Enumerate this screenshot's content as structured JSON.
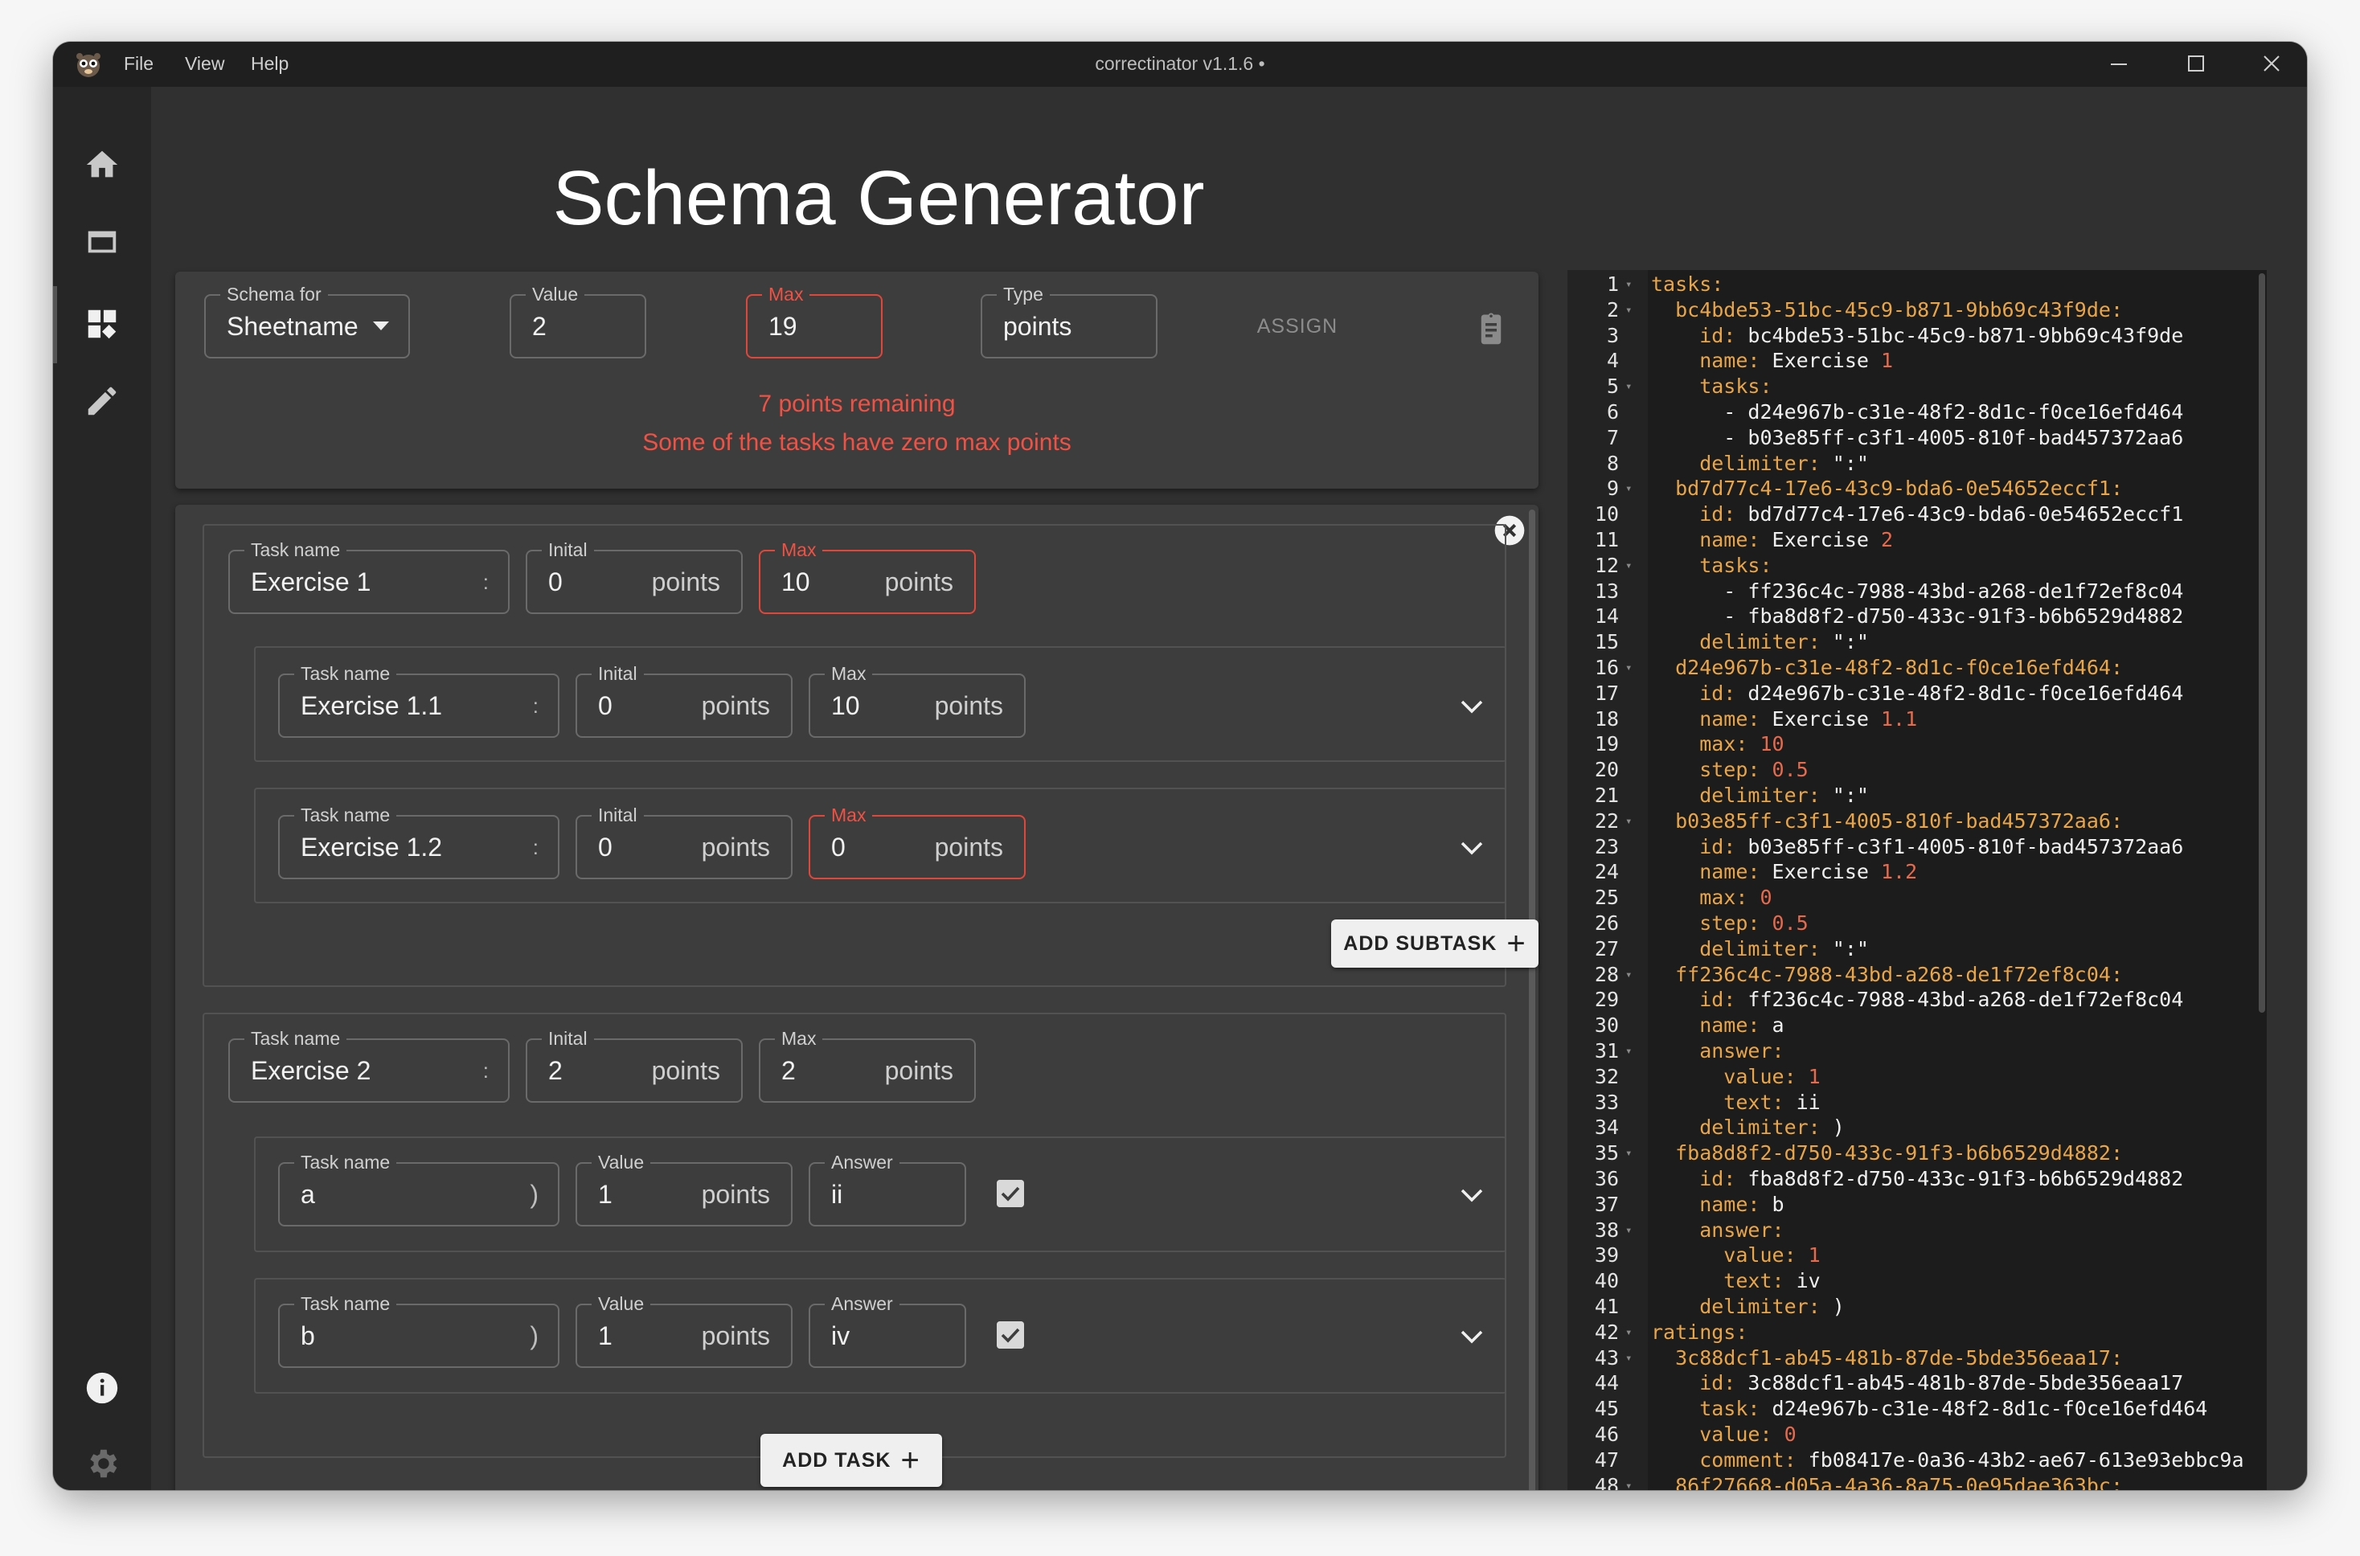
{
  "window": {
    "title": "correctinator v1.1.6 •",
    "menu": [
      "File",
      "View",
      "Help"
    ]
  },
  "page": {
    "title": "Schema Generator"
  },
  "top_panel": {
    "schema_for": {
      "label": "Schema for",
      "value": "Sheetname"
    },
    "value": {
      "label": "Value",
      "value": "2"
    },
    "max": {
      "label": "Max",
      "value": "19"
    },
    "type": {
      "label": "Type",
      "value": "points"
    },
    "assign_label": "ASSIGN",
    "messages": [
      "7 points remaining",
      "Some of the tasks have zero max points"
    ]
  },
  "task1": {
    "name": {
      "label": "Task name",
      "value": "Exercise 1",
      "delimiter": ":"
    },
    "initial": {
      "label": "Inital",
      "value": "0",
      "unit": "points"
    },
    "max": {
      "label": "Max",
      "value": "10",
      "unit": "points"
    },
    "subtasks": [
      {
        "name": {
          "label": "Task name",
          "value": "Exercise 1.1",
          "delimiter": ":"
        },
        "initial": {
          "label": "Inital",
          "value": "0",
          "unit": "points"
        },
        "max": {
          "label": "Max",
          "value": "10",
          "unit": "points"
        }
      },
      {
        "name": {
          "label": "Task name",
          "value": "Exercise 1.2",
          "delimiter": ":"
        },
        "initial": {
          "label": "Inital",
          "value": "0",
          "unit": "points"
        },
        "max": {
          "label": "Max",
          "value": "0",
          "unit": "points"
        }
      }
    ],
    "add_subtask_label": "ADD SUBTASK"
  },
  "task2": {
    "name": {
      "label": "Task name",
      "value": "Exercise 2",
      "delimiter": ":"
    },
    "initial": {
      "label": "Inital",
      "value": "2",
      "unit": "points"
    },
    "max": {
      "label": "Max",
      "value": "2",
      "unit": "points"
    },
    "subtasks": [
      {
        "name": {
          "label": "Task name",
          "value": "a",
          "delimiter": ")"
        },
        "value": {
          "label": "Value",
          "value": "1",
          "unit": "points"
        },
        "answer": {
          "label": "Answer",
          "value": "ii"
        },
        "checked": true
      },
      {
        "name": {
          "label": "Task name",
          "value": "b",
          "delimiter": ")"
        },
        "value": {
          "label": "Value",
          "value": "1",
          "unit": "points"
        },
        "answer": {
          "label": "Answer",
          "value": "iv"
        },
        "checked": true
      }
    ]
  },
  "add_task_label": "ADD TASK",
  "colors": {
    "error": "#ef5244",
    "yaml_key": "#e8a54a",
    "yaml_number": "#e76a4d"
  },
  "yaml": {
    "lines": [
      {
        "n": "1",
        "fold": true,
        "parts": [
          {
            "t": "tasks:",
            "c": "k"
          }
        ]
      },
      {
        "n": "2",
        "fold": true,
        "parts": [
          {
            "t": "  bc4bde53-51bc-45c9-b871-9bb69c43f9de:",
            "c": "k"
          }
        ]
      },
      {
        "n": "3",
        "fold": false,
        "parts": [
          {
            "t": "    id: ",
            "c": "k"
          },
          {
            "t": "bc4bde53-51bc-45c9-b871-9bb69c43f9de",
            "c": "v"
          }
        ]
      },
      {
        "n": "4",
        "fold": false,
        "parts": [
          {
            "t": "    name: ",
            "c": "k"
          },
          {
            "t": "Exercise ",
            "c": "v"
          },
          {
            "t": "1",
            "c": "n"
          }
        ]
      },
      {
        "n": "5",
        "fold": true,
        "parts": [
          {
            "t": "    tasks:",
            "c": "k"
          }
        ]
      },
      {
        "n": "6",
        "fold": false,
        "parts": [
          {
            "t": "      - d24e967b-c31e-48f2-8d1c-f0ce16efd464",
            "c": "v"
          }
        ]
      },
      {
        "n": "7",
        "fold": false,
        "parts": [
          {
            "t": "      - b03e85ff-c3f1-4005-810f-bad457372aa6",
            "c": "v"
          }
        ]
      },
      {
        "n": "8",
        "fold": false,
        "parts": [
          {
            "t": "    delimiter: ",
            "c": "k"
          },
          {
            "t": "\":\"",
            "c": "s"
          }
        ]
      },
      {
        "n": "9",
        "fold": true,
        "parts": [
          {
            "t": "  bd7d77c4-17e6-43c9-bda6-0e54652eccf1:",
            "c": "k"
          }
        ]
      },
      {
        "n": "10",
        "fold": false,
        "parts": [
          {
            "t": "    id: ",
            "c": "k"
          },
          {
            "t": "bd7d77c4-17e6-43c9-bda6-0e54652eccf1",
            "c": "v"
          }
        ]
      },
      {
        "n": "11",
        "fold": false,
        "parts": [
          {
            "t": "    name: ",
            "c": "k"
          },
          {
            "t": "Exercise ",
            "c": "v"
          },
          {
            "t": "2",
            "c": "n"
          }
        ]
      },
      {
        "n": "12",
        "fold": true,
        "parts": [
          {
            "t": "    tasks:",
            "c": "k"
          }
        ]
      },
      {
        "n": "13",
        "fold": false,
        "parts": [
          {
            "t": "      - ff236c4c-7988-43bd-a268-de1f72ef8c04",
            "c": "v"
          }
        ]
      },
      {
        "n": "14",
        "fold": false,
        "parts": [
          {
            "t": "      - fba8d8f2-d750-433c-91f3-b6b6529d4882",
            "c": "v"
          }
        ]
      },
      {
        "n": "15",
        "fold": false,
        "parts": [
          {
            "t": "    delimiter: ",
            "c": "k"
          },
          {
            "t": "\":\"",
            "c": "s"
          }
        ]
      },
      {
        "n": "16",
        "fold": true,
        "parts": [
          {
            "t": "  d24e967b-c31e-48f2-8d1c-f0ce16efd464:",
            "c": "k"
          }
        ]
      },
      {
        "n": "17",
        "fold": false,
        "parts": [
          {
            "t": "    id: ",
            "c": "k"
          },
          {
            "t": "d24e967b-c31e-48f2-8d1c-f0ce16efd464",
            "c": "v"
          }
        ]
      },
      {
        "n": "18",
        "fold": false,
        "parts": [
          {
            "t": "    name: ",
            "c": "k"
          },
          {
            "t": "Exercise ",
            "c": "v"
          },
          {
            "t": "1.1",
            "c": "n"
          }
        ]
      },
      {
        "n": "19",
        "fold": false,
        "parts": [
          {
            "t": "    max: ",
            "c": "k"
          },
          {
            "t": "10",
            "c": "n"
          }
        ]
      },
      {
        "n": "20",
        "fold": false,
        "parts": [
          {
            "t": "    step: ",
            "c": "k"
          },
          {
            "t": "0.5",
            "c": "n"
          }
        ]
      },
      {
        "n": "21",
        "fold": false,
        "parts": [
          {
            "t": "    delimiter: ",
            "c": "k"
          },
          {
            "t": "\":\"",
            "c": "s"
          }
        ]
      },
      {
        "n": "22",
        "fold": true,
        "parts": [
          {
            "t": "  b03e85ff-c3f1-4005-810f-bad457372aa6:",
            "c": "k"
          }
        ]
      },
      {
        "n": "23",
        "fold": false,
        "parts": [
          {
            "t": "    id: ",
            "c": "k"
          },
          {
            "t": "b03e85ff-c3f1-4005-810f-bad457372aa6",
            "c": "v"
          }
        ]
      },
      {
        "n": "24",
        "fold": false,
        "parts": [
          {
            "t": "    name: ",
            "c": "k"
          },
          {
            "t": "Exercise ",
            "c": "v"
          },
          {
            "t": "1.2",
            "c": "n"
          }
        ]
      },
      {
        "n": "25",
        "fold": false,
        "parts": [
          {
            "t": "    max: ",
            "c": "k"
          },
          {
            "t": "0",
            "c": "n"
          }
        ]
      },
      {
        "n": "26",
        "fold": false,
        "parts": [
          {
            "t": "    step: ",
            "c": "k"
          },
          {
            "t": "0.5",
            "c": "n"
          }
        ]
      },
      {
        "n": "27",
        "fold": false,
        "parts": [
          {
            "t": "    delimiter: ",
            "c": "k"
          },
          {
            "t": "\":\"",
            "c": "s"
          }
        ]
      },
      {
        "n": "28",
        "fold": true,
        "parts": [
          {
            "t": "  ff236c4c-7988-43bd-a268-de1f72ef8c04:",
            "c": "k"
          }
        ]
      },
      {
        "n": "29",
        "fold": false,
        "parts": [
          {
            "t": "    id: ",
            "c": "k"
          },
          {
            "t": "ff236c4c-7988-43bd-a268-de1f72ef8c04",
            "c": "v"
          }
        ]
      },
      {
        "n": "30",
        "fold": false,
        "parts": [
          {
            "t": "    name: ",
            "c": "k"
          },
          {
            "t": "a",
            "c": "v"
          }
        ]
      },
      {
        "n": "31",
        "fold": true,
        "parts": [
          {
            "t": "    answer:",
            "c": "k"
          }
        ]
      },
      {
        "n": "32",
        "fold": false,
        "parts": [
          {
            "t": "      value: ",
            "c": "k"
          },
          {
            "t": "1",
            "c": "n"
          }
        ]
      },
      {
        "n": "33",
        "fold": false,
        "parts": [
          {
            "t": "      text: ",
            "c": "k"
          },
          {
            "t": "ii",
            "c": "v"
          }
        ]
      },
      {
        "n": "34",
        "fold": false,
        "parts": [
          {
            "t": "    delimiter: ",
            "c": "k"
          },
          {
            "t": ")",
            "c": "v"
          }
        ]
      },
      {
        "n": "35",
        "fold": true,
        "parts": [
          {
            "t": "  fba8d8f2-d750-433c-91f3-b6b6529d4882:",
            "c": "k"
          }
        ]
      },
      {
        "n": "36",
        "fold": false,
        "parts": [
          {
            "t": "    id: ",
            "c": "k"
          },
          {
            "t": "fba8d8f2-d750-433c-91f3-b6b6529d4882",
            "c": "v"
          }
        ]
      },
      {
        "n": "37",
        "fold": false,
        "parts": [
          {
            "t": "    name: ",
            "c": "k"
          },
          {
            "t": "b",
            "c": "v"
          }
        ]
      },
      {
        "n": "38",
        "fold": true,
        "parts": [
          {
            "t": "    answer:",
            "c": "k"
          }
        ]
      },
      {
        "n": "39",
        "fold": false,
        "parts": [
          {
            "t": "      value: ",
            "c": "k"
          },
          {
            "t": "1",
            "c": "n"
          }
        ]
      },
      {
        "n": "40",
        "fold": false,
        "parts": [
          {
            "t": "      text: ",
            "c": "k"
          },
          {
            "t": "iv",
            "c": "v"
          }
        ]
      },
      {
        "n": "41",
        "fold": false,
        "parts": [
          {
            "t": "    delimiter: ",
            "c": "k"
          },
          {
            "t": ")",
            "c": "v"
          }
        ]
      },
      {
        "n": "42",
        "fold": true,
        "parts": [
          {
            "t": "ratings:",
            "c": "k"
          }
        ]
      },
      {
        "n": "43",
        "fold": true,
        "parts": [
          {
            "t": "  3c88dcf1-ab45-481b-87de-5bde356eaa17:",
            "c": "k"
          }
        ]
      },
      {
        "n": "44",
        "fold": false,
        "parts": [
          {
            "t": "    id: ",
            "c": "k"
          },
          {
            "t": "3c88dcf1-ab45-481b-87de-5bde356eaa17",
            "c": "v"
          }
        ]
      },
      {
        "n": "45",
        "fold": false,
        "parts": [
          {
            "t": "    task: ",
            "c": "k"
          },
          {
            "t": "d24e967b-c31e-48f2-8d1c-f0ce16efd464",
            "c": "v"
          }
        ]
      },
      {
        "n": "46",
        "fold": false,
        "parts": [
          {
            "t": "    value: ",
            "c": "k"
          },
          {
            "t": "0",
            "c": "n"
          }
        ]
      },
      {
        "n": "47",
        "fold": false,
        "parts": [
          {
            "t": "    comment: ",
            "c": "k"
          },
          {
            "t": "fb08417e-0a36-43b2-ae67-613e93ebbc9a",
            "c": "v"
          }
        ]
      },
      {
        "n": "48",
        "fold": true,
        "parts": [
          {
            "t": "  86f27668-d05a-4a36-8a75-0e95dae363bc:",
            "c": "k"
          }
        ]
      }
    ]
  }
}
